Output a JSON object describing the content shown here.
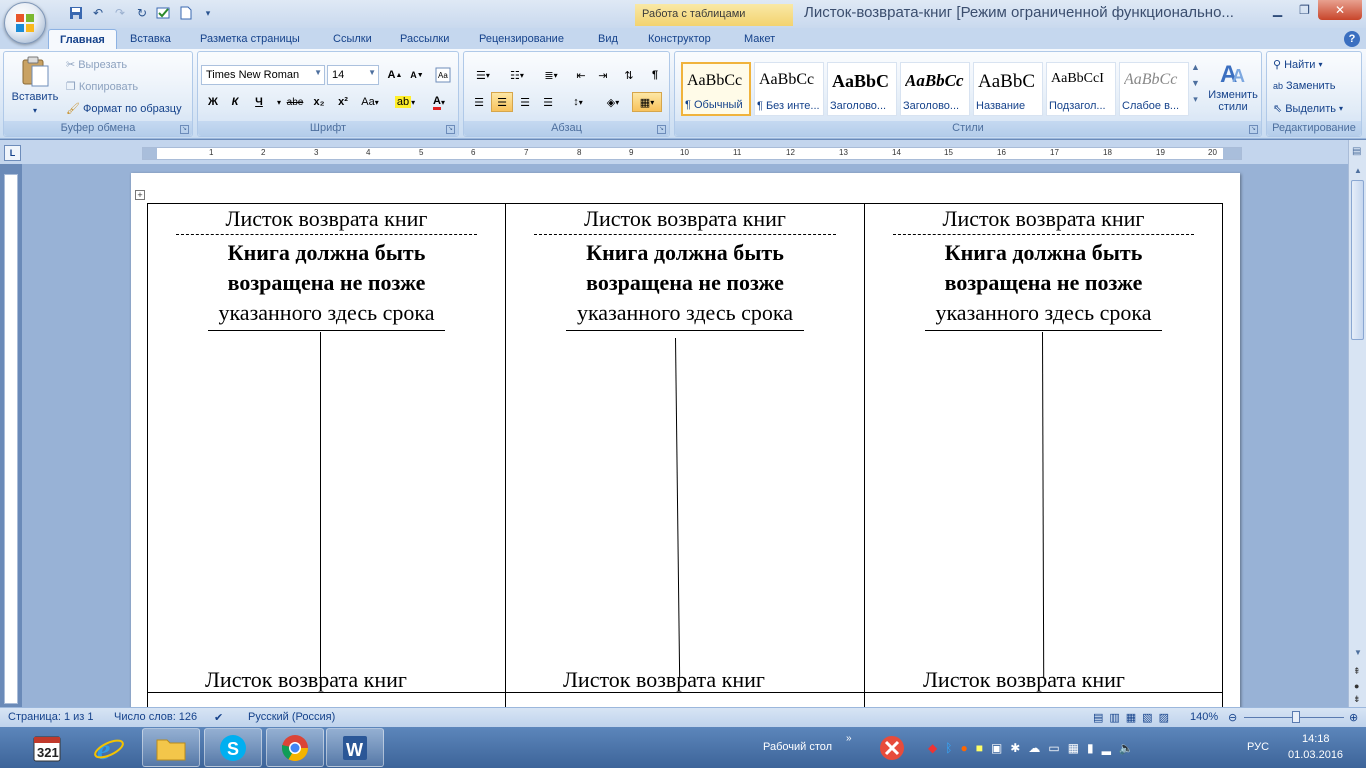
{
  "window": {
    "title": "Листок-возврата-книг [Режим ограниченной функционально...",
    "contextual_tab_group": "Работа с таблицами"
  },
  "tabs": [
    "Главная",
    "Вставка",
    "Разметка страницы",
    "Ссылки",
    "Рассылки",
    "Рецензирование",
    "Вид",
    "Конструктор",
    "Макет"
  ],
  "ribbon": {
    "clipboard": {
      "label": "Буфер обмена",
      "paste": "Вставить",
      "cut": "Вырезать",
      "copy": "Копировать",
      "format_painter": "Формат по образцу"
    },
    "font": {
      "label": "Шрифт",
      "font_name": "Times New Roman",
      "font_size": "14",
      "bold": "Ж",
      "italic": "К",
      "underline": "Ч",
      "strike": "abe",
      "sub": "x₂",
      "sup": "x²",
      "case": "Aa"
    },
    "paragraph": {
      "label": "Абзац"
    },
    "styles": {
      "label": "Стили",
      "items": [
        {
          "sample": "AaBbCc",
          "name": "¶ Обычный"
        },
        {
          "sample": "AaBbCc",
          "name": "¶ Без инте..."
        },
        {
          "sample": "AaBbC",
          "name": "Заголово..."
        },
        {
          "sample": "AaBbCc",
          "name": "Заголово..."
        },
        {
          "sample": "AaBbC",
          "name": "Название"
        },
        {
          "sample": "AaBbCcI",
          "name": "Подзагол..."
        },
        {
          "sample": "AaBbCc",
          "name": "Слабое в..."
        }
      ],
      "change_styles": "Изменить стили"
    },
    "editing": {
      "label": "Редактирование",
      "find": "Найти",
      "replace": "Заменить",
      "select": "Выделить"
    }
  },
  "ruler": {
    "numbers": [
      "1",
      "1",
      "2",
      "3",
      "4",
      "5",
      "6",
      "7",
      "8",
      "9",
      "10",
      "11",
      "12",
      "13",
      "14",
      "15",
      "16",
      "17",
      "18",
      "19",
      "20"
    ]
  },
  "document": {
    "cells": [
      {
        "title": "Листок возврата книг",
        "bold_line1": "Книга должна быть",
        "bold_line2": "возращена не позже",
        "normal": "указанного здесь срока"
      },
      {
        "title": "Листок возврата книг",
        "bold_line1": "Книга должна быть",
        "bold_line2": "возращена не позже",
        "normal": "указанного здесь срока"
      },
      {
        "title": "Листок возврата книг",
        "bold_line1": "Книга должна быть",
        "bold_line2": "возращена не позже",
        "normal": "указанного здесь срока"
      }
    ],
    "next_row_title": "Листок возврата книг"
  },
  "statusbar": {
    "page": "Страница: 1 из 1",
    "words": "Число слов: 126",
    "language": "Русский (Россия)",
    "zoom": "140%"
  },
  "taskbar": {
    "desktop_label": "Рабочий стол",
    "lang": "РУС",
    "time": "14:18",
    "date": "01.03.2016"
  }
}
